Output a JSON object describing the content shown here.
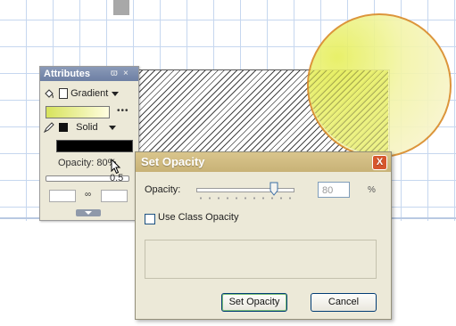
{
  "attributes_panel": {
    "title": "Attributes",
    "pin_glyph": "ϖ",
    "close_glyph": "×",
    "fill_type": "Gradient",
    "stroke_type": "Solid",
    "more_glyph": "•••",
    "opacity_label": "Opacity: 80%",
    "stroke_width_value": "0.5",
    "link_glyph": "∞",
    "fill_colors": {
      "start": "#d7e35c",
      "end": "#fffde0"
    },
    "stroke_color": "#000000"
  },
  "dialog": {
    "title": "Set Opacity",
    "close_glyph": "X",
    "opacity_label": "Opacity:",
    "opacity_value": "80",
    "percent_sign": "%",
    "slider_level": 0.8,
    "use_class_opacity_label": "Use Class Opacity",
    "use_class_opacity_checked": false,
    "set_button_label": "Set Opacity",
    "cancel_button_label": "Cancel"
  },
  "icons": {
    "fill": "paint-bucket-icon",
    "stroke": "pen-icon",
    "cursor": "mouse-pointer-icon"
  }
}
